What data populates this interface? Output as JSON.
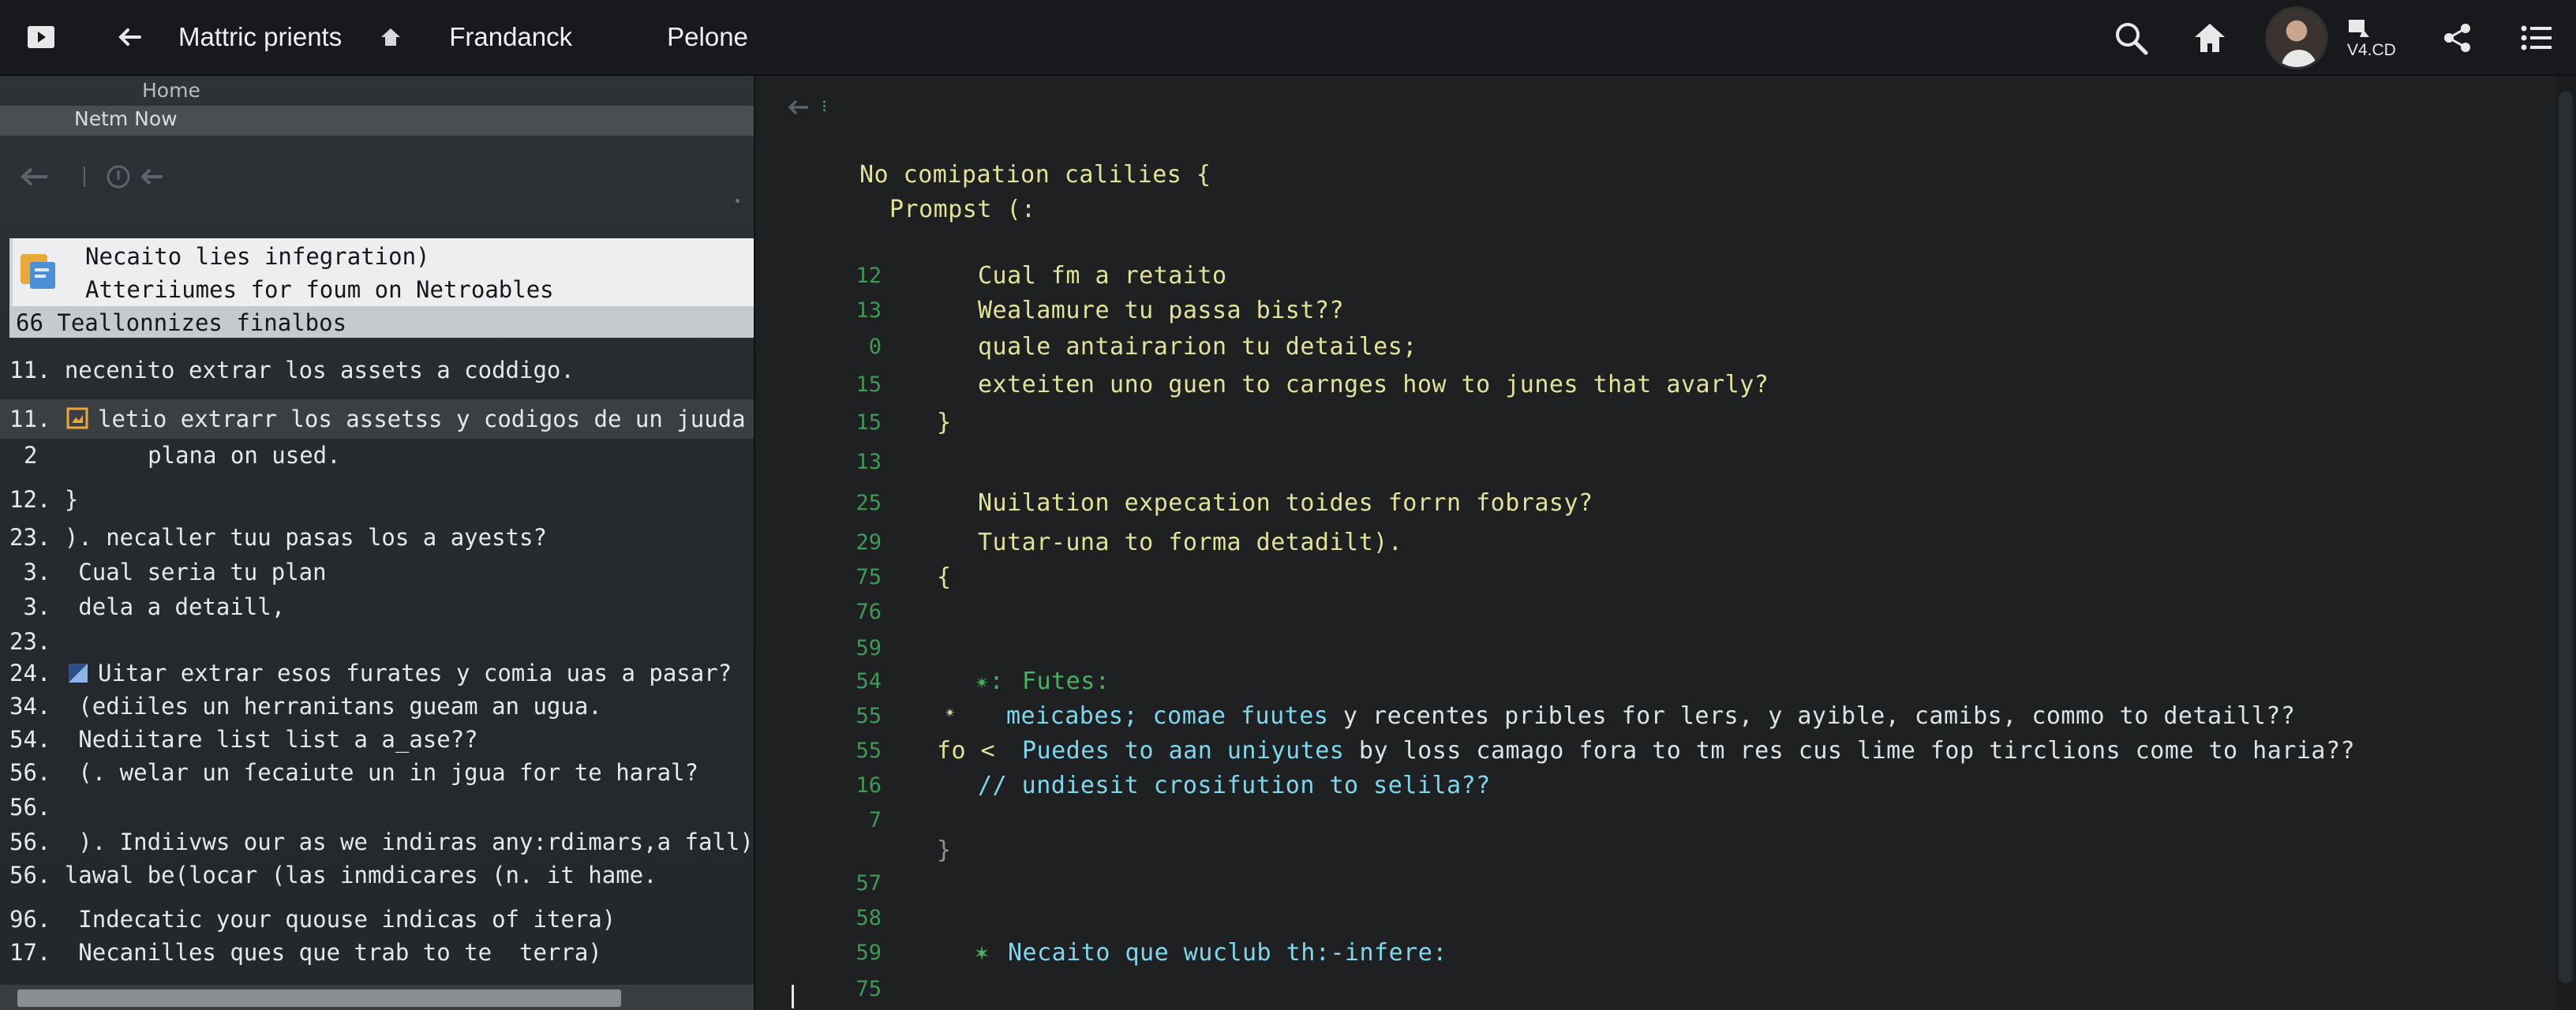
{
  "topbar": {
    "title": "Mattric prients",
    "tab1": "Frandanck",
    "tab2": "Pelone",
    "version": "V4.CD"
  },
  "left_panel": {
    "crumb_home": "Home",
    "crumb_current": "Netm Now",
    "selected_title": "Necaito lies infegration)",
    "selected_subtitle": "Atteriiumes for foum on Netroables",
    "selected_row": "66 Teallonnizes finalbos",
    "lines": [
      "11. necenito extrar los assets a coddigo.",
      "11.",
      "letio extrarr los assetss y codigos de un juuda",
      "2        plana on used.",
      "12. }",
      "23. ). necaller tuu pasas los a ayests?",
      " 3.  Cual seria tu plan",
      " 3.  dela a detaill,",
      "23.",
      "24.",
      "Uitar extrar esos furates y comia uas a pasar?",
      "34.  (ediiles un herranitans gueam an ugua.",
      "54.  Nediitare list list a a_ase??",
      "56.  (. welar un ſecaiute un in jgua for te haral?",
      "56.",
      "56.  ). Indiivws our as we indiras any:rdimars,a fall)",
      "56. lawal be(locar (las inmdicares (n. it hame.",
      "96.  Indecatic your quouse indicas of itera)",
      "17.  Necanilles ques que trab to te  terra)"
    ]
  },
  "editor": {
    "lines": {
      "l1": "No comipation calilies {",
      "l2": "Prompst (:",
      "l3": "Cual fm a retaito",
      "l4": "Wealamure tu passa bist??",
      "l5": "quale antairarion tu detailes;",
      "l6": "exteiten uno guen to carnges how to junes that avarly?",
      "l7": "}",
      "l8": "Nuilation expecation toides forrn fobrasy?",
      "l9": "Tutar-una to forma detadilt).",
      "l10": "{",
      "l11_prefix": "✴: ",
      "l11": "Futes:",
      "l12_prefix": "✴",
      "l12_cyan": "meicabes; comae fuutes",
      "l12_white": " y recentes pribles for lers, y ayible, camibs, commo to detaill??",
      "l13_prefix": "fo <",
      "l13_cyan": "Puedes to aan uniyutes",
      "l13_white": " by loss camago fora to tm res cus lime fop tirclions come to haria??",
      "l14": "// undiesit crosifution to selila??",
      "l15": "}",
      "l16_prefix": "✶",
      "l16": "Necaito que wuclub th:-infere:"
    },
    "gutter": [
      "12",
      "13",
      "0",
      "15",
      "15",
      "13",
      "25",
      "29",
      "75",
      "76",
      "59",
      "54",
      "55",
      "55",
      "16",
      "7",
      "57",
      "58",
      "59",
      "75"
    ]
  },
  "icons": {
    "menu_square": "play-square-icon",
    "back": "arrow-left-icon",
    "home_small": "home-icon",
    "search": "search-icon",
    "home": "home-icon",
    "user": "avatar",
    "device": "device-icon",
    "share": "share-icon",
    "list": "list-icon"
  },
  "colors": {
    "accent_yellow": "#e2e29a",
    "accent_cyan": "#7fd7ee",
    "gutter_green": "#3f9a55"
  }
}
